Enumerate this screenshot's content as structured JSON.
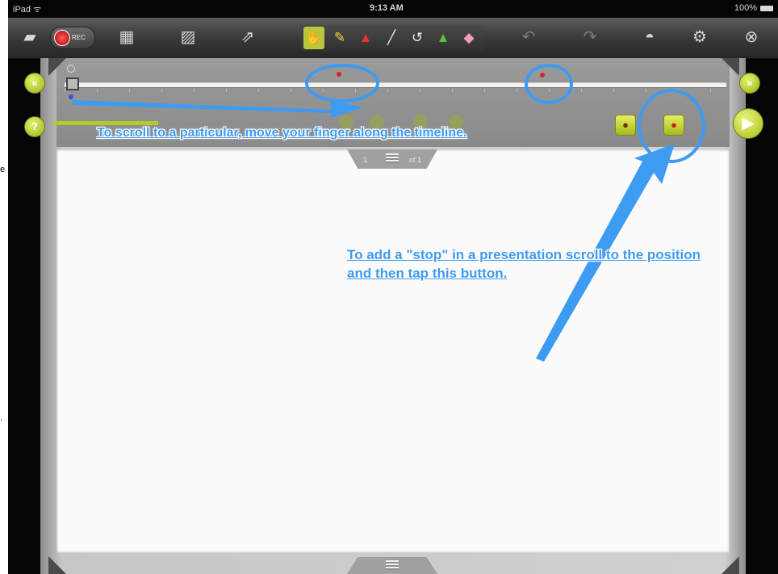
{
  "status_bar": {
    "carrier": "iPad ᯤ",
    "time": "9:13 AM",
    "battery": "100%"
  },
  "toolbar": {
    "record_label": "REC",
    "icons": [
      "folder-icon",
      "record-icon",
      "slideshow-icon",
      "image-icon",
      "share-icon",
      "select-tool-icon",
      "highlighter-tool-icon",
      "pen-tool-icon",
      "line-tool-icon",
      "lasso-tool-icon",
      "shape-tool-icon",
      "eraser-tool-icon",
      "undo-icon",
      "redo-icon",
      "mask-icon",
      "gear-icon",
      "close-icon"
    ]
  },
  "timeline": {
    "stop_markers": 2,
    "page_indicator_left": "1",
    "page_indicator_right": "of 1"
  },
  "annotations": {
    "scroll_tip": "To scroll to a particular, move your finger along the timeline.",
    "stop_tip": "To add a \"stop\" in a presentation scroll to the position and then tap this button."
  },
  "edge_text": {
    "top": "e",
    "bottom": "."
  },
  "colors": {
    "annotation_blue": "#3e9bf2",
    "accent_green": "#a5bd1c",
    "stop_red": "#e02020"
  }
}
